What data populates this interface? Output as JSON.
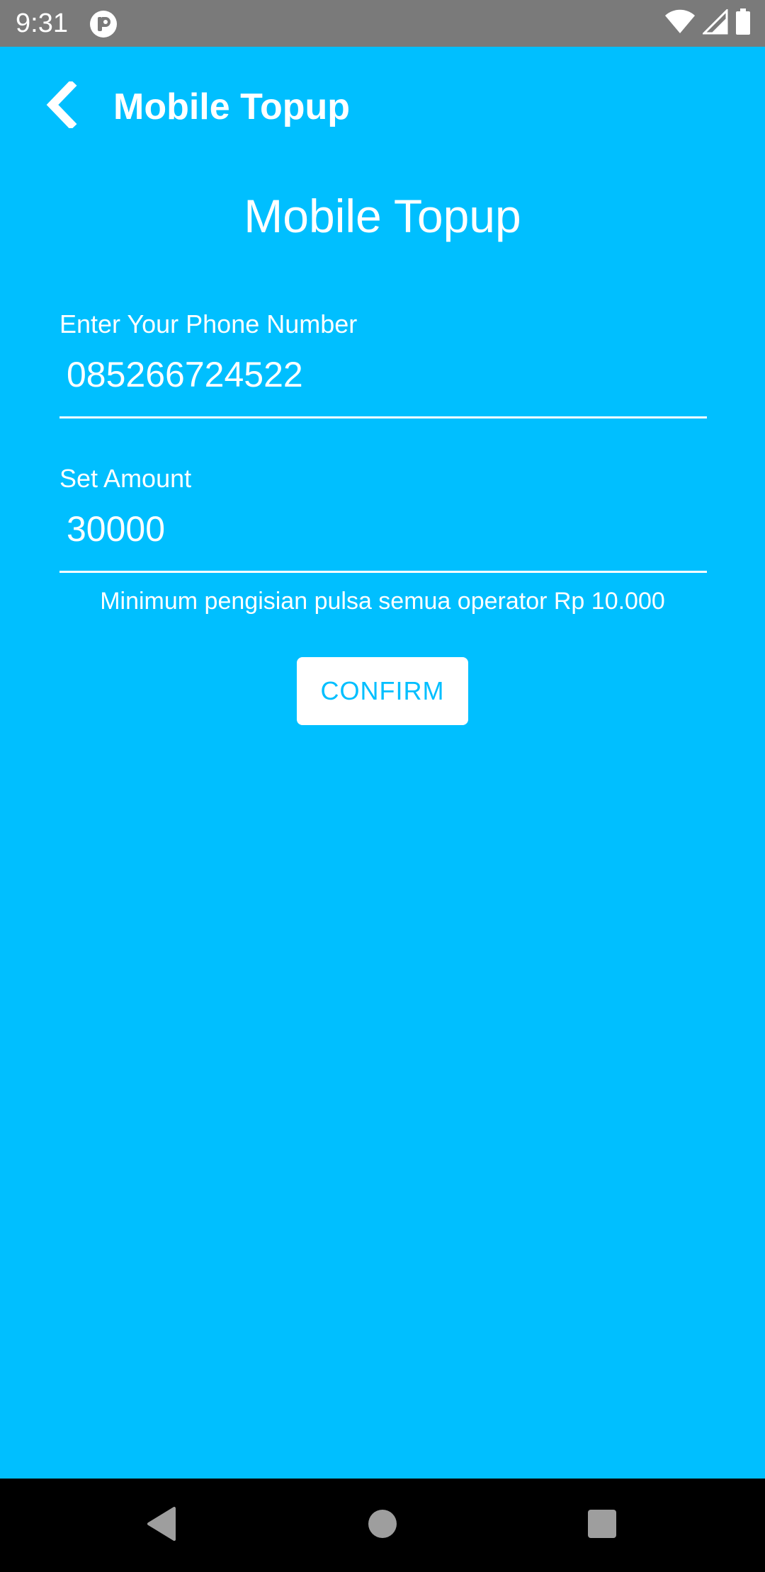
{
  "status_bar": {
    "time": "9:31",
    "app_icon": "app-notification-icon",
    "icons": [
      "wifi-icon",
      "cell-signal-icon",
      "battery-icon"
    ]
  },
  "app_bar": {
    "back_icon": "chevron-left-icon",
    "title": "Mobile Topup"
  },
  "page": {
    "title": "Mobile Topup"
  },
  "phone_field": {
    "label": "Enter Your Phone Number",
    "value": "085266724522"
  },
  "amount_field": {
    "label": "Set Amount",
    "value": "30000"
  },
  "hint": "Minimum pengisian pulsa semua operator Rp 10.000",
  "confirm_button": {
    "label": "CONFIRM"
  },
  "nav_bar": {
    "icons": [
      "back-triangle-icon",
      "home-circle-icon",
      "recents-square-icon"
    ]
  },
  "colors": {
    "background": "#00BFFF",
    "status_bar": "#7a7a7a",
    "nav_bar": "#000000",
    "text": "#ffffff",
    "button_bg": "#ffffff",
    "button_text": "#00BFFF"
  }
}
